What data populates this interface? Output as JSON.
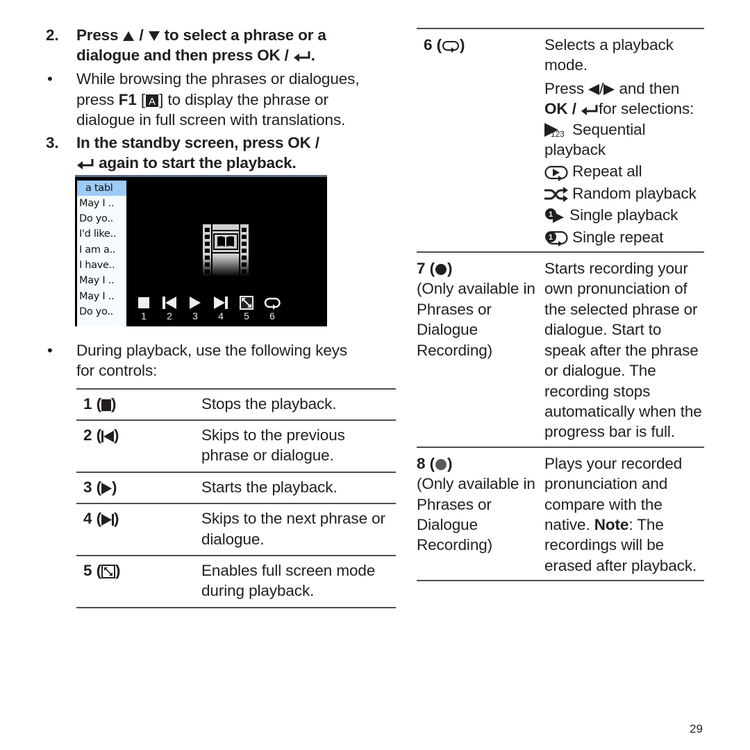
{
  "page_number": "29",
  "left": {
    "step2": {
      "number": "2.",
      "text_a": "Press",
      "sep": "/",
      "text_b": "to select a phrase or a dialogue and then press OK /",
      "end": "."
    },
    "bullet1": {
      "text_a": "While browsing the phrases or dialogues, press",
      "key": "F1",
      "bracket_open": "[",
      "key_icon_letter": "A",
      "bracket_close": "]",
      "text_b": "to display the phrase or dialogue in full screen with translations."
    },
    "step3": {
      "number": "3.",
      "text_a": "In the standby screen, press OK /",
      "text_b": "again to start the playback."
    },
    "device_screen": {
      "list": [
        "a tabl",
        "May I ..",
        "Do yo..",
        "I'd like..",
        "I am a..",
        "I have..",
        "May I ..",
        "May I ..",
        "Do yo.."
      ],
      "selected_index": 0,
      "controls": [
        {
          "label": "1",
          "icon": "stop-icon"
        },
        {
          "label": "2",
          "icon": "previous-icon"
        },
        {
          "label": "3",
          "icon": "play-icon"
        },
        {
          "label": "4",
          "icon": "next-icon"
        },
        {
          "label": "5",
          "icon": "fullscreen-icon"
        },
        {
          "label": "6",
          "icon": "repeat-icon"
        }
      ],
      "colors": {
        "background": "#000000",
        "list_bg": "#f6fbff",
        "selected_bg": "#9ecbf5"
      }
    },
    "bullet2": {
      "text": "During playback, use the following keys for controls:"
    },
    "table": [
      {
        "key": "1 (",
        "key_end": ")",
        "icon": "stop-icon",
        "desc": "Stops the playback."
      },
      {
        "key": "2 (",
        "key_end": ")",
        "icon": "previous-icon",
        "desc": "Skips to the previous phrase or dialogue."
      },
      {
        "key": "3 (",
        "key_end": ")",
        "icon": "play-icon",
        "desc": "Starts the playback."
      },
      {
        "key": "4 (",
        "key_end": ")",
        "icon": "next-icon",
        "desc": "Skips to the next phrase or dialogue."
      },
      {
        "key": "5 (",
        "key_end": ")",
        "icon": "fullscreen-icon",
        "desc": "Enables full screen mode during playback."
      }
    ]
  },
  "right": {
    "row6": {
      "key": "6 (",
      "key_end": ")",
      "icon": "repeat-icon",
      "desc_a": "Selects a playback mode.",
      "desc_b_1": "Press",
      "desc_b_sep": "/",
      "desc_b_2": "and then",
      "desc_b_ok": "OK /",
      "desc_b_3": "for selections:",
      "modes": [
        {
          "icon": "sequential-icon",
          "label": "Sequential playback"
        },
        {
          "icon": "repeat-all-icon",
          "label": "Repeat all"
        },
        {
          "icon": "random-icon",
          "label": "Random playback"
        },
        {
          "icon": "single-playback-icon",
          "label": "Single playback"
        },
        {
          "icon": "single-repeat-icon",
          "label": "Single repeat"
        }
      ],
      "sequential_sub": "123"
    },
    "row7": {
      "key": "7 (",
      "key_end": ")",
      "icon": "record-icon",
      "note": "(Only available in Phrases or Dialogue Recording)",
      "desc": "Starts recording your own pronunciation of the selected phrase or dialogue. Start to speak after the phrase or dialogue. The recording stops automatically when the progress bar is full."
    },
    "row8": {
      "key": "8 (",
      "key_end": ")",
      "icon": "playback-recording-icon",
      "note": "(Only available in Phrases or Dialogue Recording)",
      "desc_a": "Plays your recorded pronunciation and compare with the native.",
      "note_label": "Note",
      "desc_b": ": The recordings will be erased after playback."
    }
  }
}
